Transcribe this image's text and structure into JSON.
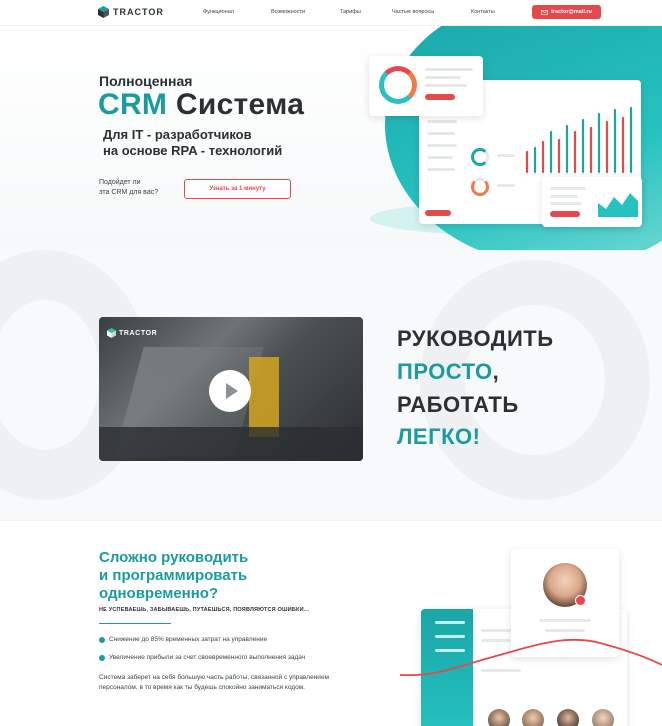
{
  "header": {
    "logo_text": "TRACTOR",
    "nav": [
      "Функционал",
      "Возможности",
      "Тарифы",
      "Частые вопросы",
      "Контакты"
    ],
    "email_label": "tractor@mail.ru",
    "email_icon": "mail-icon"
  },
  "hero": {
    "kicker": "Полноценная",
    "title_accent": "CRM",
    "title_rest": " Система",
    "subtitle_line1": "Для IT - разработчиков",
    "subtitle_line2": "на основе RPA - технологий",
    "question_line1": "Подойдет ли",
    "question_line2": "эта CRM для вас?",
    "cta_label": "Узнать за 1 минуту"
  },
  "video_section": {
    "video_logo": "TRACTOR",
    "motto_line1": "РУКОВОДИТЬ",
    "motto_line2": "ПРОСТО",
    "motto_line2_suffix": ",",
    "motto_line3": "РАБОТАТЬ",
    "motto_line4": "ЛЕГКО!"
  },
  "problem_section": {
    "heading_line1": "Сложно руководить",
    "heading_line2": "и программировать",
    "heading_line3": "одновременно?",
    "caps": "НЕ УСПЕВАЕШЬ, ЗАБЫВАЕШЬ, ПУТАЕШЬСЯ, ПОЯВЛЯЮТСЯ ОШИБКИ...",
    "bullets": [
      "Снижение до 85% временных затрат на управление",
      "Увеличение прибыли за счет своевременного выполнения задач"
    ],
    "paragraph": "Система заберет на себя большую часть работы, связанной с управлением персоналом, в то время как ты будешь спокойно заниматься кодом."
  },
  "colors": {
    "accent": "#1a9ba0",
    "brand_red": "#e5484d",
    "text_dark": "#2a3033"
  }
}
